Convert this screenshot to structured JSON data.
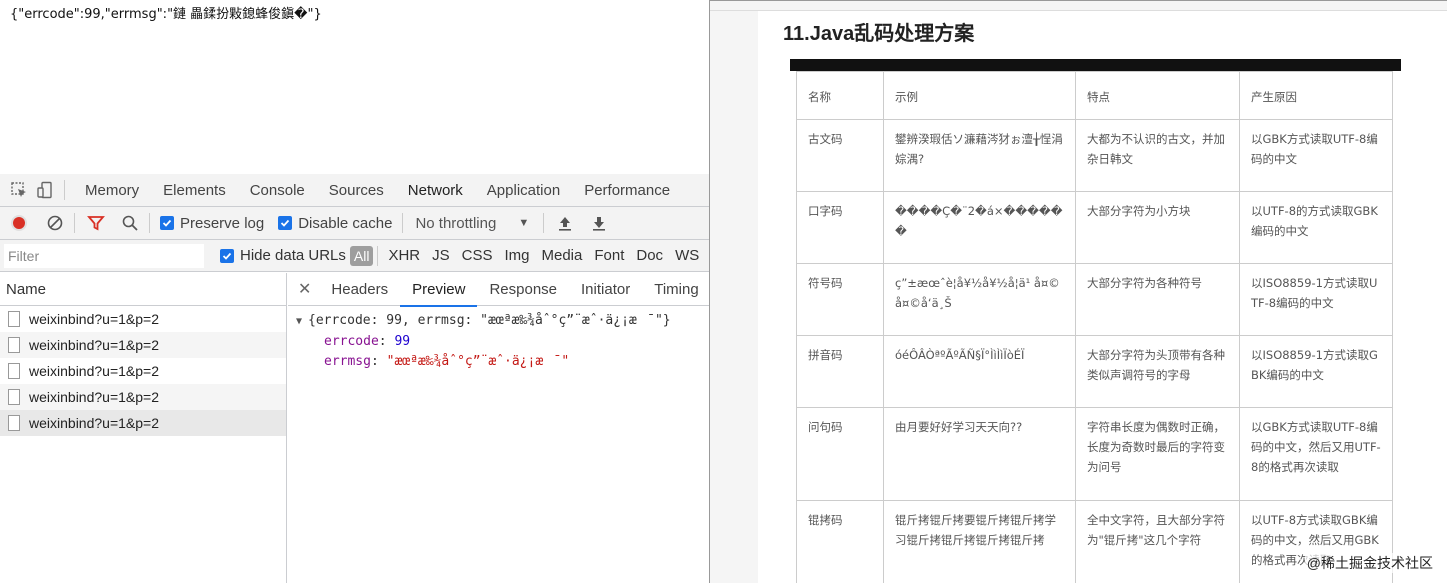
{
  "raw_response": "{\"errcode\":99,\"errmsg\":\"鏈  畾鍒扮敤鎴蜂俊鎭�\"}",
  "devtools": {
    "main_tabs": [
      "Memory",
      "Elements",
      "Console",
      "Sources",
      "Network",
      "Application",
      "Performance"
    ],
    "active_tab": "Network",
    "toolbar": {
      "preserve_log": "Preserve log",
      "disable_cache": "Disable cache",
      "throttling": "No throttling"
    },
    "filter": {
      "placeholder": "Filter",
      "hide_data_urls": "Hide data URLs",
      "types": [
        "All",
        "XHR",
        "JS",
        "CSS",
        "Img",
        "Media",
        "Font",
        "Doc",
        "WS"
      ]
    },
    "request_list": {
      "header": "Name",
      "rows": [
        "weixinbind?u=1&p=2",
        "weixinbind?u=1&p=2",
        "weixinbind?u=1&p=2",
        "weixinbind?u=1&p=2",
        "weixinbind?u=1&p=2"
      ]
    },
    "detail_tabs": [
      "Headers",
      "Preview",
      "Response",
      "Initiator",
      "Timing"
    ],
    "active_detail_tab": "Preview",
    "preview": {
      "summary": "{errcode: 99, errmsg: \"æœªæ‰¾åˆ°ç”¨æˆ·ä¿¡æ¯\"}",
      "key1": "errcode",
      "val1": "99",
      "key2": "errmsg",
      "val2": "\"æœªæ‰¾åˆ°ç”¨æˆ·ä¿¡æ¯\""
    }
  },
  "article": {
    "title": "11.Java乱码处理方案",
    "table": {
      "headers": [
        "名称",
        "示例",
        "特点",
        "产生原因"
      ],
      "rows": [
        [
          "古文码",
          "鐢辨湀瑕佸ソ濂藉涔犲ぉ澶╁悜涓婃湡?",
          "大都为不认识的古文，并加杂日韩文",
          "以GBK方式读取UTF-8编码的中文"
        ],
        [
          "口字码",
          "����Ç�¨2�á×������",
          "大部分字符为小方块",
          "以UTF-8的方式读取GBK编码的中文"
        ],
        [
          "符号码",
          "ç”±æœˆè¦å¥½å¥½å­¦ä¹ å¤©å¤©å‘ä¸Š",
          "大部分字符为各种符号",
          "以ISO8859-1方式读取UTF-8编码的中文"
        ],
        [
          "拼音码",
          "óéÔÂÒªºÃºÃÑ§Ï°ÌìÌìÏòÉÏ",
          "大部分字符为头顶带有各种类似声调符号的字母",
          "以ISO8859-1方式读取GBK编码的中文"
        ],
        [
          "问句码",
          "由月要好好学习天天向??",
          "字符串长度为偶数时正确，长度为奇数时最后的字符变为问号",
          "以GBK方式读取UTF-8编码的中文，然后又用UTF-8的格式再次读取"
        ],
        [
          "锟拷码",
          "锟斤拷锟斤拷要锟斤拷锟斤拷学习锟斤拷锟斤拷锟斤拷锟斤拷",
          "全中文字符，且大部分字符为\"锟斤拷\"这几个字符",
          "以UTF-8方式读取GBK编码的中文，然后又用GBK的格式再次读取"
        ]
      ]
    },
    "watermark": "@稀土掘金技术社区"
  }
}
